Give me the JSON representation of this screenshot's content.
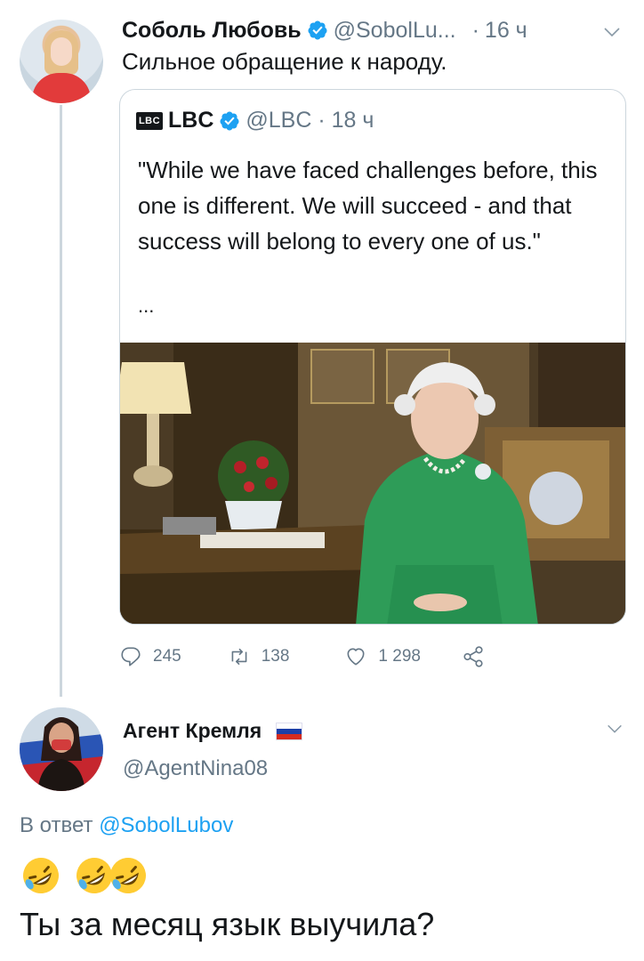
{
  "tweet": {
    "author_name": "Соболь Любовь",
    "author_handle": "@SobolLu...",
    "time_sep": "·",
    "time": "16 ч",
    "text": "Сильное обращение к народу.",
    "quoted": {
      "logo_text": "LBC",
      "name": "LBC",
      "handle_time": "@LBC · 18 ч",
      "text": "\"While we have faced challenges before, this one is different. We will succeed - and that success will belong to every one of us.\"",
      "ellipsis": "..."
    },
    "actions": {
      "replies": "245",
      "retweets": "138",
      "likes": "1 298"
    }
  },
  "reply": {
    "author_name": "Агент Кремля",
    "author_handle": "@AgentNina08",
    "reply_prefix": "В ответ",
    "reply_to": "@SobolLubov",
    "emojis": [
      "rolling-on-floor-laughing",
      "rolling-on-floor-laughing",
      "rolling-on-floor-laughing"
    ],
    "text": "Ты за месяц язык выучила?"
  },
  "colors": {
    "link": "#1da1f2",
    "muted": "#657786",
    "verified": "#1da1f2",
    "border": "#ccd6dd"
  }
}
